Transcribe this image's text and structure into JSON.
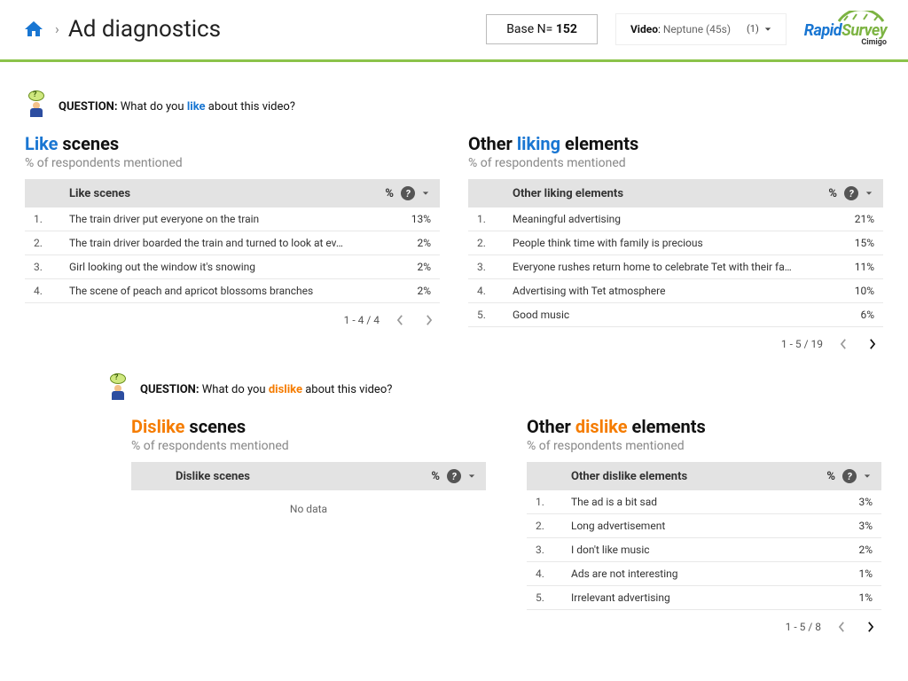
{
  "header": {
    "title": "Ad diagnostics",
    "base_label": "Base N=",
    "base_n": "152",
    "video_label": "Video",
    "video_name": "Neptune (45s)",
    "video_sel": "(1)",
    "logo_rapid": "Rapid",
    "logo_survey": "Survey",
    "logo_sub": "Cimigo"
  },
  "q1": {
    "label_q": "QUESTION:",
    "label_pre": "What do you ",
    "label_word": "like",
    "label_post": " about this video?"
  },
  "like_scenes": {
    "title_pre": "Like",
    "title_post": " scenes",
    "sub": "% of respondents mentioned",
    "th": "Like scenes",
    "pct": "%",
    "rows": [
      {
        "n": "1.",
        "t": "The train driver put everyone on the train",
        "p": "13%"
      },
      {
        "n": "2.",
        "t": "The train driver boarded the train and turned to look at ev…",
        "p": "2%"
      },
      {
        "n": "3.",
        "t": "Girl looking out the window it's snowing",
        "p": "2%"
      },
      {
        "n": "4.",
        "t": "The scene of peach and apricot blossoms branches",
        "p": "2%"
      }
    ],
    "range": "1 - 4 / 4"
  },
  "like_elem": {
    "title_pre": "Other ",
    "title_word": "liking",
    "title_post": " elements",
    "sub": "% of respondents mentioned",
    "th": "Other liking elements",
    "pct": "%",
    "rows": [
      {
        "n": "1.",
        "t": "Meaningful advertising",
        "p": "21%"
      },
      {
        "n": "2.",
        "t": "People think time with family is precious",
        "p": "15%"
      },
      {
        "n": "3.",
        "t": "Everyone rushes return home to celebrate Tet with their fa…",
        "p": "11%"
      },
      {
        "n": "4.",
        "t": "Advertising with Tet atmosphere",
        "p": "10%"
      },
      {
        "n": "5.",
        "t": "Good music",
        "p": "6%"
      }
    ],
    "range": "1 - 5 / 19"
  },
  "q2": {
    "label_q": "QUESTION:",
    "label_pre": "What do you ",
    "label_word": "dislike",
    "label_post": " about this video?"
  },
  "dislike_scenes": {
    "title_pre": "Dislike",
    "title_post": " scenes",
    "sub": "% of respondents mentioned",
    "th": "Dislike scenes",
    "pct": "%",
    "nodata": "No data"
  },
  "dislike_elem": {
    "title_pre": "Other ",
    "title_word": "dislike",
    "title_post": " elements",
    "sub": "% of respondents mentioned",
    "th": "Other dislike elements",
    "pct": "%",
    "rows": [
      {
        "n": "1.",
        "t": "The ad is a bit sad",
        "p": "3%"
      },
      {
        "n": "2.",
        "t": "Long advertisement",
        "p": "3%"
      },
      {
        "n": "3.",
        "t": "I don't like music",
        "p": "2%"
      },
      {
        "n": "4.",
        "t": "Ads are not interesting",
        "p": "1%"
      },
      {
        "n": "5.",
        "t": "Irrelevant advertising",
        "p": "1%"
      }
    ],
    "range": "1 - 5 / 8"
  }
}
